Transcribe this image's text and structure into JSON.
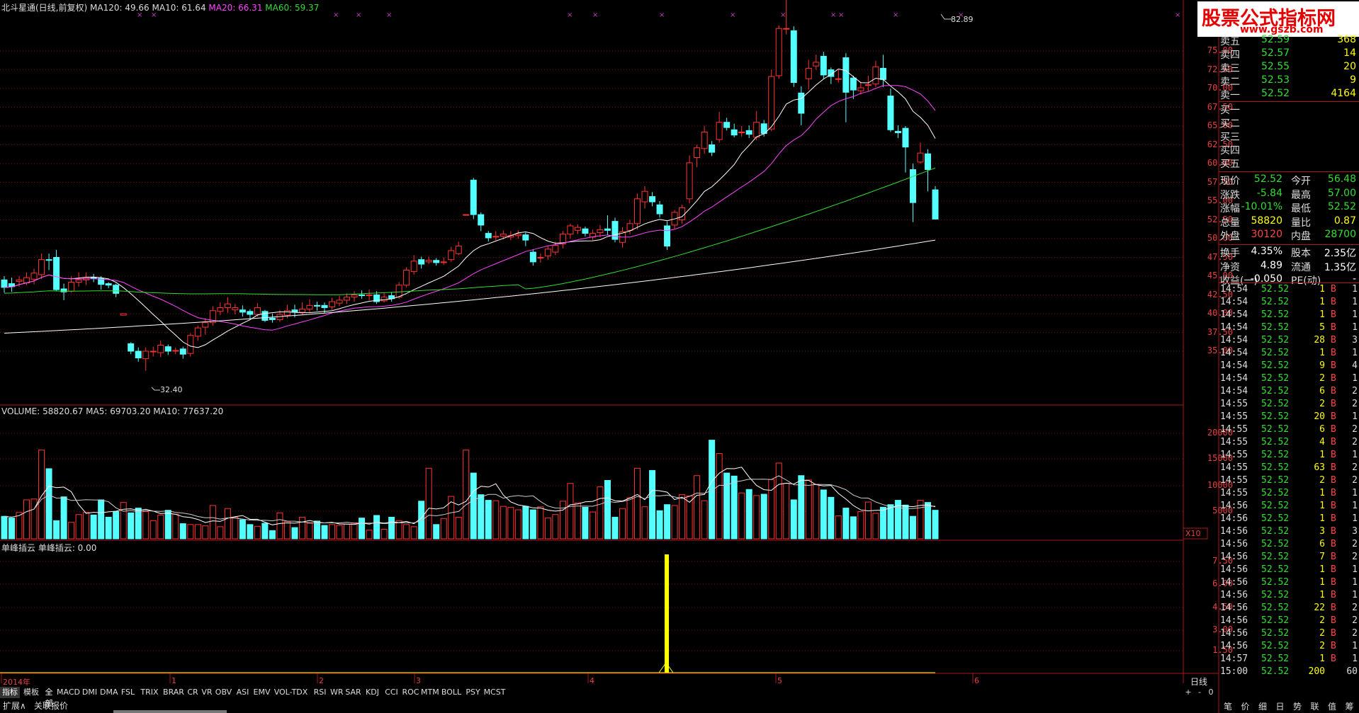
{
  "main_header": {
    "title": "北斗星通(日线,前复权)",
    "ma120": "MA120: 49.66",
    "ma10": "MA10: 61.64",
    "ma20": "MA20: 66.31",
    "ma60": "MA60: 59.37"
  },
  "price_axis": [
    "75.00",
    "72.50",
    "70.00",
    "67.50",
    "65.00",
    "62.50",
    "60.00",
    "57.50",
    "55.00",
    "52.50",
    "50.00",
    "47.50",
    "45.00",
    "42.50",
    "40.00",
    "37.50",
    "35.00"
  ],
  "annotations": {
    "high": "82.89",
    "low": "32.40"
  },
  "volume_header": "VOLUME: 58820.67  MA5: 69703.20  MA10: 77637.20",
  "volume_axis": [
    "20000",
    "15000",
    "10000",
    "5000"
  ],
  "volume_unit": "X10",
  "indicator_header": "单峰插云  单峰插云: 0.00",
  "indicator_axis": [
    "7.50",
    "6.00",
    "4.50",
    "3.00",
    "1.50"
  ],
  "time_axis": [
    "2014年",
    "1",
    "2",
    "3",
    "4",
    "5",
    "6"
  ],
  "period_label": "日线",
  "bottom_tabs": {
    "primary": [
      "指标",
      "模板"
    ],
    "indicators": [
      "全部",
      "MACD",
      "DMI",
      "DMA",
      "FSL",
      "TRIX",
      "BRAR",
      "CR",
      "VR",
      "OBV",
      "ASI",
      "EMV",
      "VOL-TDX",
      "RSI",
      "WR",
      "SAR",
      "KDJ",
      "CCI",
      "ROC",
      "MTM",
      "BOLL",
      "PSY",
      "MCST"
    ],
    "controls": [
      "+",
      "-",
      "0"
    ],
    "status": [
      "扩展∧",
      "关联报价"
    ]
  },
  "watermark": {
    "line1": "股票公式指标网",
    "line2": "www.gszb.com"
  },
  "order_book": {
    "asks": [
      {
        "label": "卖五",
        "price": "52.59",
        "vol": "368"
      },
      {
        "label": "卖四",
        "price": "52.57",
        "vol": "14"
      },
      {
        "label": "卖三",
        "price": "52.55",
        "vol": "20"
      },
      {
        "label": "卖二",
        "price": "52.53",
        "vol": "9"
      },
      {
        "label": "卖一",
        "price": "52.52",
        "vol": "4164"
      }
    ],
    "bids": [
      "买一",
      "买二",
      "买三",
      "买四",
      "买五"
    ]
  },
  "quote": [
    {
      "l1": "现价",
      "v1": "52.52",
      "l2": "今开",
      "v2": "56.48"
    },
    {
      "l1": "涨跌",
      "v1": "-5.84",
      "l2": "最高",
      "v2": "57.00"
    },
    {
      "l1": "涨幅",
      "v1": "-10.01%",
      "l2": "最低",
      "v2": "52.52"
    },
    {
      "l1": "总量",
      "v1": "58820",
      "l2": "量比",
      "v2": "0.87"
    },
    {
      "l1": "外盘",
      "v1": "30120",
      "l2": "内盘",
      "v2": "28700"
    },
    {
      "l1": "换手",
      "v1": "4.35%",
      "l2": "股本",
      "v2": "2.35亿"
    },
    {
      "l1": "净资",
      "v1": "4.89",
      "l2": "流通",
      "v2": "1.35亿"
    },
    {
      "l1": "收益(一)",
      "v1": "-0.050",
      "l2": "PE(动)",
      "v2": "-"
    }
  ],
  "ticks": [
    [
      "14:54",
      "52.52",
      "1",
      "B",
      "1"
    ],
    [
      "14:54",
      "52.52",
      "1",
      "B",
      "1"
    ],
    [
      "14:54",
      "52.52",
      "1",
      "B",
      "1"
    ],
    [
      "14:54",
      "52.52",
      "5",
      "B",
      "1"
    ],
    [
      "14:54",
      "52.52",
      "28",
      "B",
      "3"
    ],
    [
      "14:54",
      "52.52",
      "1",
      "B",
      "1"
    ],
    [
      "14:54",
      "52.52",
      "9",
      "B",
      "4"
    ],
    [
      "14:54",
      "52.52",
      "2",
      "B",
      "1"
    ],
    [
      "14:54",
      "52.52",
      "6",
      "B",
      "2"
    ],
    [
      "14:55",
      "52.52",
      "2",
      "B",
      "2"
    ],
    [
      "14:55",
      "52.52",
      "20",
      "B",
      "1"
    ],
    [
      "14:55",
      "52.52",
      "6",
      "B",
      "2"
    ],
    [
      "14:55",
      "52.52",
      "4",
      "B",
      "2"
    ],
    [
      "14:55",
      "52.52",
      "1",
      "B",
      "1"
    ],
    [
      "14:55",
      "52.52",
      "63",
      "B",
      "2"
    ],
    [
      "14:55",
      "52.52",
      "2",
      "B",
      "2"
    ],
    [
      "14:55",
      "52.52",
      "1",
      "B",
      "1"
    ],
    [
      "14:56",
      "52.52",
      "1",
      "B",
      "1"
    ],
    [
      "14:56",
      "52.52",
      "1",
      "B",
      "1"
    ],
    [
      "14:56",
      "52.52",
      "3",
      "B",
      "3"
    ],
    [
      "14:56",
      "52.52",
      "6",
      "B",
      "2"
    ],
    [
      "14:56",
      "52.52",
      "7",
      "B",
      "2"
    ],
    [
      "14:56",
      "52.52",
      "1",
      "B",
      "1"
    ],
    [
      "14:56",
      "52.52",
      "1",
      "B",
      "1"
    ],
    [
      "14:56",
      "52.52",
      "1",
      "B",
      "1"
    ],
    [
      "14:56",
      "52.52",
      "22",
      "B",
      "2"
    ],
    [
      "14:56",
      "52.52",
      "2",
      "B",
      "2"
    ],
    [
      "14:56",
      "52.52",
      "2",
      "B",
      "2"
    ],
    [
      "14:56",
      "52.52",
      "2",
      "B",
      "1"
    ],
    [
      "14:57",
      "52.52",
      "1",
      "B",
      "1"
    ],
    [
      "15:00",
      "52.52",
      "200",
      "",
      "60"
    ]
  ],
  "side_tabs": [
    "笔",
    "价",
    "细",
    "日",
    "势",
    "联",
    "值",
    "筹"
  ],
  "colors": {
    "up": "#ff3333",
    "down": "#54ffff",
    "ma120": "#ffffff",
    "ma10": "#ffffff",
    "ma20": "#ff44ff",
    "ma60": "#33dd33",
    "grid": "#7a1010",
    "indicator": "#ffff00",
    "axis_text": "#e84040"
  }
}
